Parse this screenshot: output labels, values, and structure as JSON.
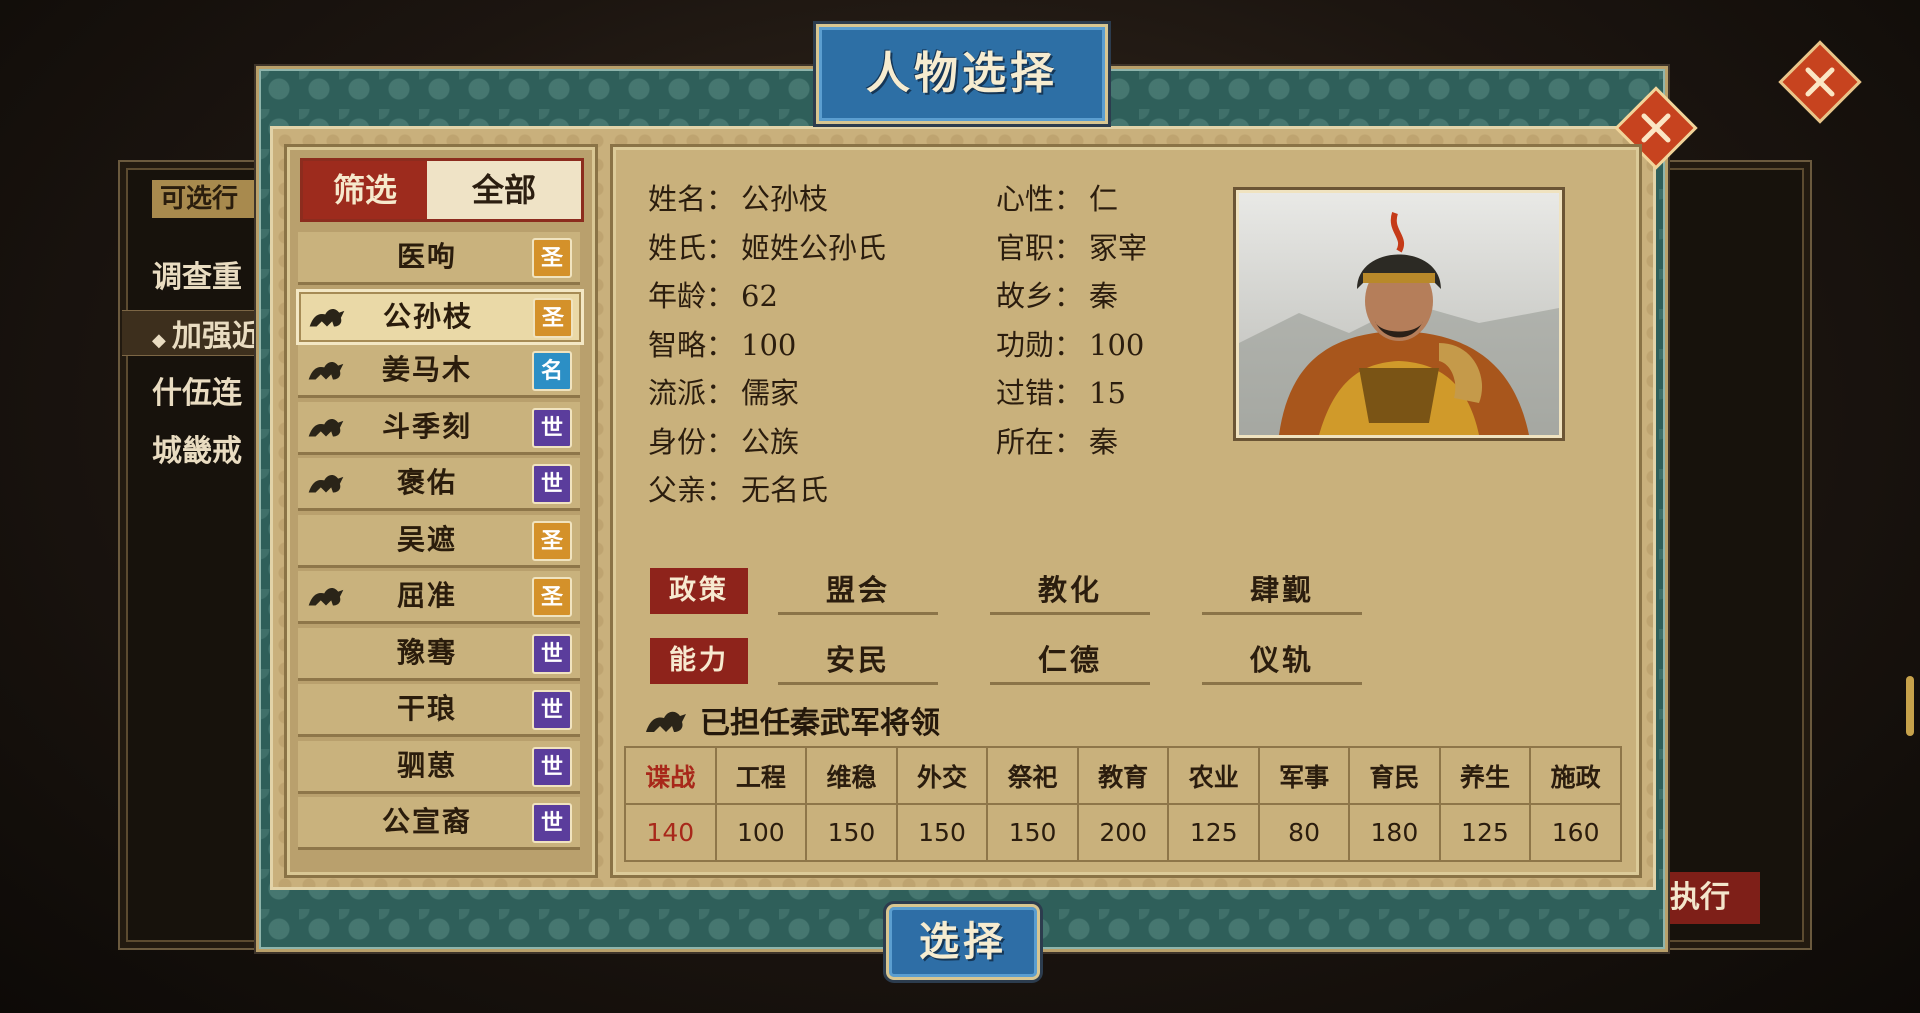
{
  "background_panel": {
    "tab_label": "可选行",
    "items": [
      "调查重",
      "加强近",
      "什伍连",
      "城畿戒"
    ],
    "execute_label": "执行"
  },
  "dialog": {
    "title": "人物选择",
    "select_label": "选择"
  },
  "filter": {
    "filter_label": "筛选",
    "all_label": "全部"
  },
  "characters": [
    {
      "name": "医呴",
      "badge": "圣",
      "badge_type": "sheng",
      "beast": false
    },
    {
      "name": "公孙枝",
      "badge": "圣",
      "badge_type": "sheng",
      "beast": true,
      "selected": true
    },
    {
      "name": "姜马木",
      "badge": "名",
      "badge_type": "ming",
      "beast": true
    },
    {
      "name": "斗季刻",
      "badge": "世",
      "badge_type": "shi",
      "beast": true
    },
    {
      "name": "褒佑",
      "badge": "世",
      "badge_type": "shi",
      "beast": true
    },
    {
      "name": "吴遮",
      "badge": "圣",
      "badge_type": "sheng",
      "beast": false
    },
    {
      "name": "屈准",
      "badge": "圣",
      "badge_type": "sheng",
      "beast": true
    },
    {
      "name": "豫骞",
      "badge": "世",
      "badge_type": "shi",
      "beast": false
    },
    {
      "name": "干琅",
      "badge": "世",
      "badge_type": "shi",
      "beast": false
    },
    {
      "name": "驷葸",
      "badge": "世",
      "badge_type": "shi",
      "beast": false
    },
    {
      "name": "公宣裔",
      "badge": "世",
      "badge_type": "shi",
      "beast": false
    }
  ],
  "detail": {
    "left_fields": [
      {
        "label": "姓名：",
        "value": "公孙枝"
      },
      {
        "label": "姓氏：",
        "value": "姬姓公孙氏"
      },
      {
        "label": "年龄：",
        "value": "62"
      },
      {
        "label": "智略：",
        "value": "100"
      },
      {
        "label": "流派：",
        "value": "儒家"
      },
      {
        "label": "身份：",
        "value": "公族"
      },
      {
        "label": "父亲：",
        "value": "无名氏"
      }
    ],
    "right_fields": [
      {
        "label": "心性：",
        "value": "仁"
      },
      {
        "label": "官职：",
        "value": "冢宰"
      },
      {
        "label": "故乡：",
        "value": "秦"
      },
      {
        "label": "功勋：",
        "value": "100"
      },
      {
        "label": "过错：",
        "value": "15"
      },
      {
        "label": "所在：",
        "value": "秦"
      }
    ],
    "policy_label": "政策",
    "policies": [
      "盟会",
      "教化",
      "肆觐"
    ],
    "ability_label": "能力",
    "abilities": [
      "安民",
      "仁德",
      "仪轨"
    ],
    "general_note": "已担任秦武军将领",
    "stats_headers": [
      "谍战",
      "工程",
      "维稳",
      "外交",
      "祭祀",
      "教育",
      "农业",
      "军事",
      "育民",
      "养生",
      "施政"
    ],
    "stats_values": [
      "140",
      "100",
      "150",
      "150",
      "150",
      "200",
      "125",
      "80",
      "180",
      "125",
      "160"
    ]
  },
  "colors": {
    "accent_red": "#9d2b1d",
    "title_blue": "#2d6fa5",
    "parchment": "#c9b17c",
    "teal_frame": "#2f5f5a"
  }
}
